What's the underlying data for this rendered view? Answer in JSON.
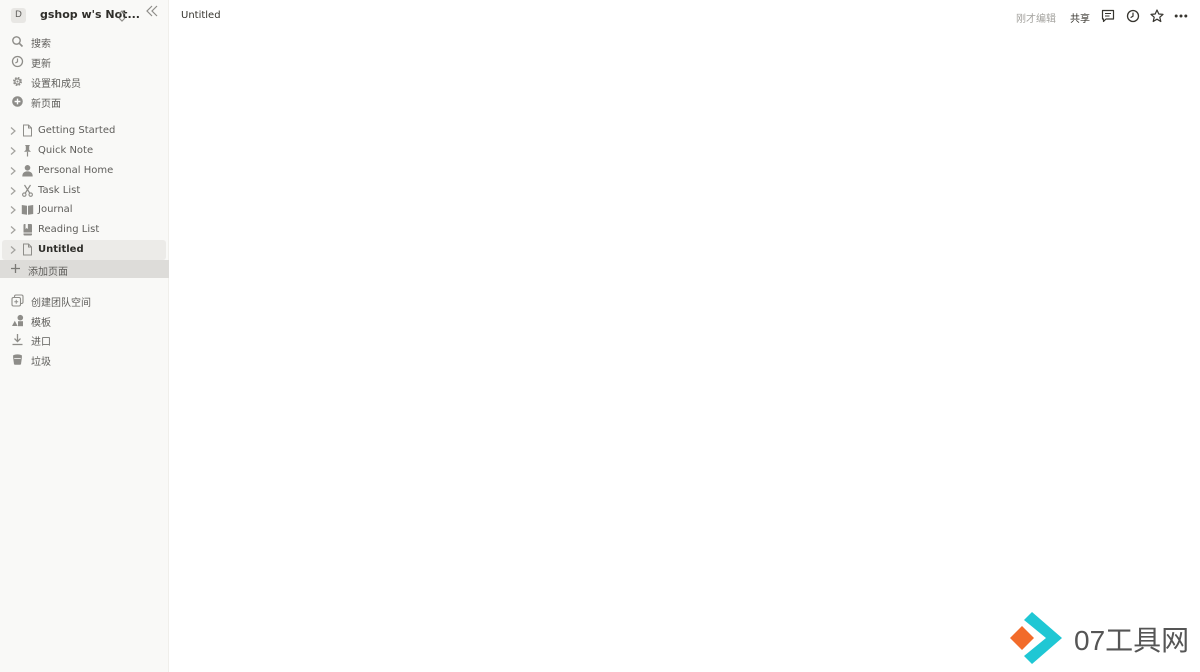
{
  "workspace": {
    "avatar_letter": "D",
    "name": "gshop w's Not..."
  },
  "nav": {
    "search": "搜索",
    "updates": "更新",
    "settings": "设置和成员",
    "new_page": "新页面"
  },
  "pages": [
    {
      "label": "Getting Started",
      "icon": "page-icon"
    },
    {
      "label": "Quick Note",
      "icon": "pin-icon"
    },
    {
      "label": "Personal Home",
      "icon": "person-icon"
    },
    {
      "label": "Task List",
      "icon": "scissors-icon"
    },
    {
      "label": "Journal",
      "icon": "book-icon"
    },
    {
      "label": "Reading List",
      "icon": "bookmark-book-icon"
    },
    {
      "label": "Untitled",
      "icon": "page-icon",
      "active": true
    }
  ],
  "add_page": "添加页面",
  "bottom_nav": {
    "create_teamspace": "创建团队空间",
    "templates": "模板",
    "import": "进口",
    "trash": "垃圾"
  },
  "topbar": {
    "title": "Untitled",
    "edited": "刚才编辑",
    "share": "共享"
  },
  "watermark": {
    "text": "07工具网"
  },
  "colors": {
    "sidebar_bg": "#f9f9f7",
    "active_item_bg": "#ecebe8",
    "add_page_bg": "#dddcd9",
    "watermark_orange": "#f26b2a",
    "watermark_cyan": "#1fc7d4"
  }
}
